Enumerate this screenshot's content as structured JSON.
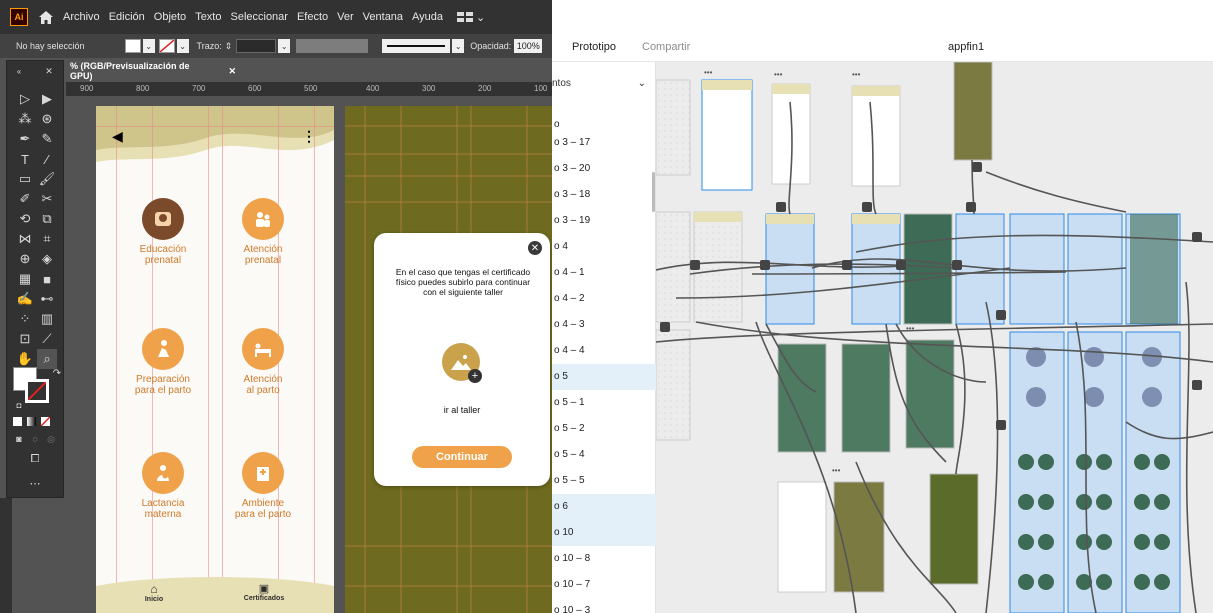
{
  "illustrator": {
    "app_logo": "Ai",
    "menu": [
      "Archivo",
      "Edición",
      "Objeto",
      "Texto",
      "Seleccionar",
      "Efecto",
      "Ver",
      "Ventana",
      "Ayuda"
    ],
    "control_bar": {
      "selection_status": "No hay selección",
      "stroke_label": "Trazo:",
      "opacity_label": "Opacidad:",
      "opacity_value": "100%"
    },
    "document_tab": "% (RGB/Previsualización de GPU)",
    "ruler_ticks": [
      "900",
      "800",
      "700",
      "600",
      "500",
      "400",
      "300",
      "200",
      "100"
    ],
    "artboard": {
      "categories": [
        {
          "label": "Educación\nprenatal",
          "icon": "mother-baby-icon"
        },
        {
          "label": "Atención\nprenatal",
          "icon": "doctor-icon"
        },
        {
          "label": "Preparación\npara el parto",
          "icon": "exercise-icon"
        },
        {
          "label": "Atención\nal parto",
          "icon": "bed-icon"
        },
        {
          "label": "Lactancia\nmaterna",
          "icon": "breastfeeding-icon"
        },
        {
          "label": "Ambiente\npara el parto",
          "icon": "hospital-icon"
        }
      ],
      "nav": [
        {
          "label": "Inicio",
          "icon": "home-icon"
        },
        {
          "label": "Certificados",
          "icon": "certificate-icon"
        }
      ]
    },
    "modal": {
      "text": "En el caso que tengas el certificado físico puedes subirlo para continuar con el siguiente taller",
      "link": "ir al taller",
      "button": "Continuar"
    }
  },
  "xd": {
    "tabs": [
      "Prototipo",
      "Compartir"
    ],
    "title": "appfin1",
    "layers_header": "ntos",
    "layers": [
      {
        "label": "o",
        "selected": false
      },
      {
        "label": "o 3 – 17",
        "selected": false
      },
      {
        "label": "o 3 – 20",
        "selected": false
      },
      {
        "label": "o 3 – 18",
        "selected": false
      },
      {
        "label": "o 3 – 19",
        "selected": false
      },
      {
        "label": "o 4",
        "selected": false
      },
      {
        "label": "o 4 – 1",
        "selected": false
      },
      {
        "label": "o 4 – 2",
        "selected": false
      },
      {
        "label": "o 4 – 3",
        "selected": false
      },
      {
        "label": "o 4 – 4",
        "selected": false
      },
      {
        "label": "o 5",
        "selected": true
      },
      {
        "label": "o 5 – 1",
        "selected": false
      },
      {
        "label": "o 5 – 2",
        "selected": false
      },
      {
        "label": "o 5 – 4",
        "selected": false
      },
      {
        "label": "o 5 – 5",
        "selected": false
      },
      {
        "label": "o 6",
        "selected": true
      },
      {
        "label": "o 10",
        "selected": true
      },
      {
        "label": "o 10 – 8",
        "selected": false
      },
      {
        "label": "o 10 – 7",
        "selected": false
      },
      {
        "label": "o 10 – 3",
        "selected": false
      }
    ],
    "colors": {
      "olive": "#6e6a1f",
      "beige": "#e8e0b5",
      "selected_blue": "#c9def3",
      "accent": "#f0a24a"
    }
  }
}
